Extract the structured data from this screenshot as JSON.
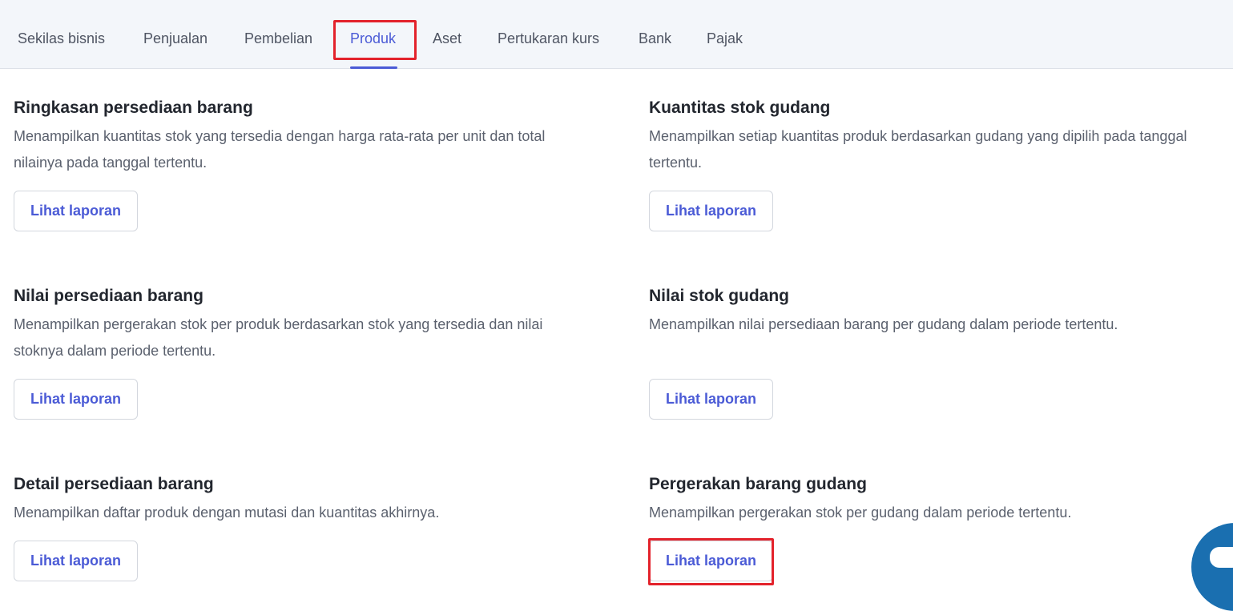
{
  "tabs": [
    {
      "label": "Sekilas bisnis"
    },
    {
      "label": "Penjualan"
    },
    {
      "label": "Pembelian"
    },
    {
      "label": "Produk"
    },
    {
      "label": "Aset"
    },
    {
      "label": "Pertukaran kurs"
    },
    {
      "label": "Bank"
    },
    {
      "label": "Pajak"
    }
  ],
  "active_tab": "Produk",
  "reports": [
    {
      "title": "Ringkasan persediaan barang",
      "description": "Menampilkan kuantitas stok yang tersedia dengan harga rata-rata per unit dan total nilainya pada tanggal tertentu.",
      "button": "Lihat laporan"
    },
    {
      "title": "Kuantitas stok gudang",
      "description": "Menampilkan setiap kuantitas produk berdasarkan gudang yang dipilih pada tanggal tertentu.",
      "button": "Lihat laporan"
    },
    {
      "title": "Nilai persediaan barang",
      "description": "Menampilkan pergerakan stok per produk berdasarkan stok yang tersedia dan nilai stoknya dalam periode tertentu.",
      "button": "Lihat laporan"
    },
    {
      "title": "Nilai stok gudang",
      "description": "Menampilkan nilai persediaan barang per gudang dalam periode tertentu.",
      "button": "Lihat laporan"
    },
    {
      "title": "Detail persediaan barang",
      "description": "Menampilkan daftar produk dengan mutasi dan kuantitas akhirnya.",
      "button": "Lihat laporan"
    },
    {
      "title": "Pergerakan barang gudang",
      "description": "Menampilkan pergerakan stok per gudang dalam periode tertentu.",
      "button": "Lihat laporan"
    }
  ],
  "colors": {
    "accent": "#4b5bd6",
    "highlight": "#e3222b",
    "chat_widget": "#1a6fb0"
  },
  "icons": {
    "chat": "chat-bubble-icon"
  }
}
